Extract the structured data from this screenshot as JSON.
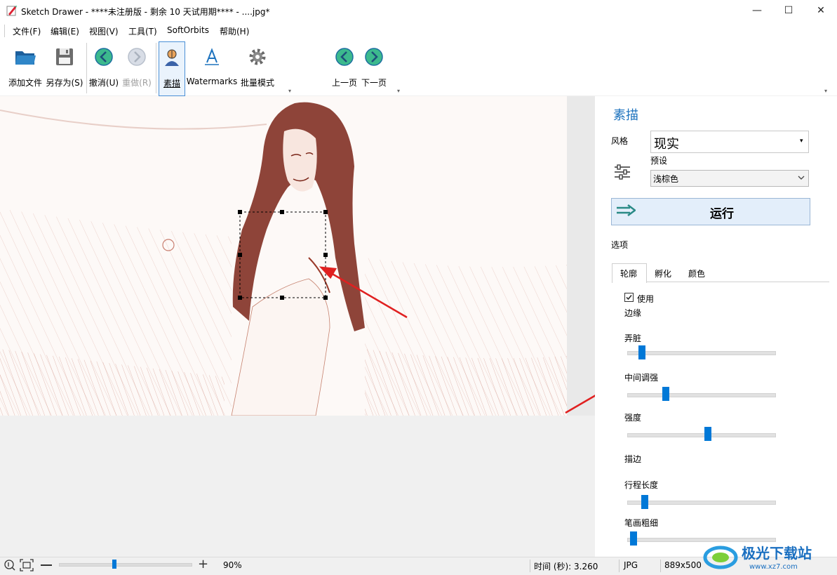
{
  "window": {
    "title": "Sketch Drawer - ****未注册版 - 剩余 10 天试用期**** - ....jpg*",
    "controls": {
      "minimize": "—",
      "maximize": "☐",
      "close": "✕"
    }
  },
  "menu": {
    "items": [
      "文件(F)",
      "编辑(E)",
      "视图(V)",
      "工具(T)",
      "SoftOrbits",
      "帮助(H)"
    ]
  },
  "toolbar": {
    "add_file": "添加文件",
    "save_as": "另存为(S)",
    "undo": "撤消(U)",
    "redo": "重做(R)",
    "sketch": "素描",
    "watermarks": "Watermarks",
    "batch_mode": "批量模式",
    "prev_page": "上一页",
    "next_page": "下一页",
    "grip": "▾"
  },
  "panel": {
    "title": "素描",
    "style_label": "风格",
    "style_value": "现实",
    "preset_label": "预设",
    "preset_value": "浅棕色",
    "run_label": "运行",
    "options_label": "选项",
    "tabs": [
      "轮廓",
      "孵化",
      "颜色"
    ],
    "use_checkbox": {
      "label": "使用",
      "checked": true
    },
    "edge_section": "边缘",
    "sliders": [
      {
        "label": "弄脏",
        "value": 0.08
      },
      {
        "label": "中间调强",
        "value": 0.25
      },
      {
        "label": "强度",
        "value": 0.55
      },
      {
        "label": "行程长度",
        "value": 0.1
      },
      {
        "label": "笔画粗细",
        "value": 0.02
      }
    ],
    "stroke_section": "描边"
  },
  "status": {
    "zoom": "90%",
    "zoom_level": 0.42,
    "time": "时间 (秒): 3.260",
    "format": "JPG",
    "size": "889x500"
  },
  "watermark": {
    "brand": "极光下载站",
    "site": "www.xz7.com"
  },
  "colors": {
    "accent": "#1e73be",
    "slider_thumb": "#0078d7",
    "sketch_ink": "#8b2a1e",
    "arrow": "#e02020"
  }
}
